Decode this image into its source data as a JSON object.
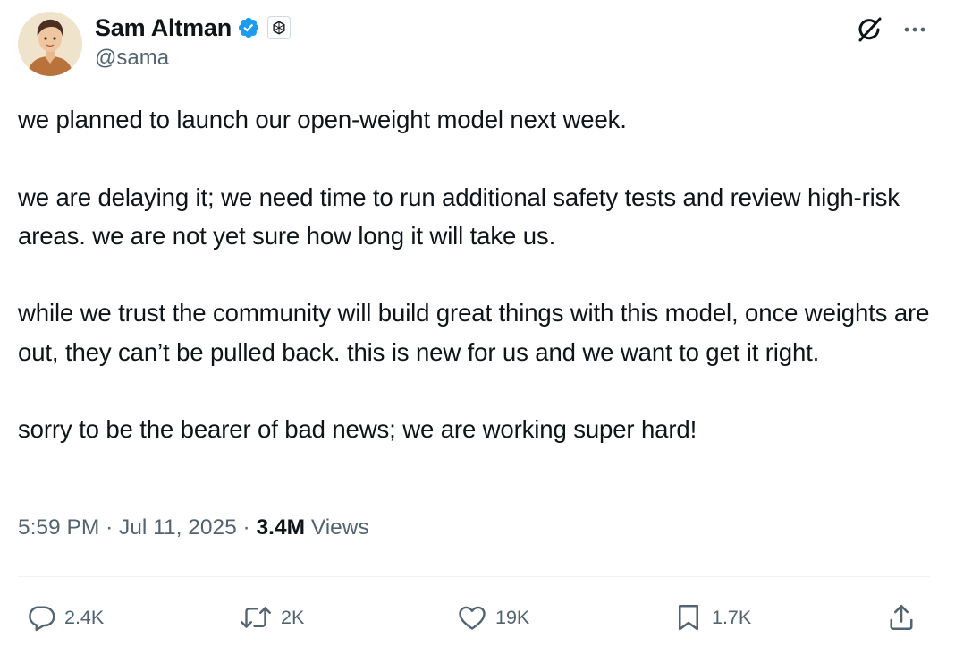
{
  "author": {
    "display_name": "Sam Altman",
    "handle": "@sama",
    "verified": true,
    "affiliation": "OpenAI"
  },
  "header_icons": [
    "grok-icon",
    "more-options-icon"
  ],
  "post": {
    "paragraphs": [
      "we planned to launch our open-weight model next week.",
      "we are delaying it; we need time to run additional safety tests and review high-risk areas. we are not yet sure how long it will take us.",
      "while we trust the community will build great things with this model, once weights are out, they can’t be pulled back. this is new for us and we want to get it right.",
      "sorry to be the bearer of bad news; we are working super hard!"
    ]
  },
  "meta": {
    "time": "5:59 PM",
    "separator": "·",
    "date": "Jul 11, 2025",
    "views_count": "3.4M",
    "views_label": "Views"
  },
  "actions": {
    "replies": "2.4K",
    "reposts": "2K",
    "likes": "19K",
    "bookmarks": "1.7K"
  },
  "colors": {
    "text_primary": "#0f1419",
    "text_secondary": "#536471",
    "verified_blue": "#1d9bf0",
    "divider": "#eff3f4"
  }
}
